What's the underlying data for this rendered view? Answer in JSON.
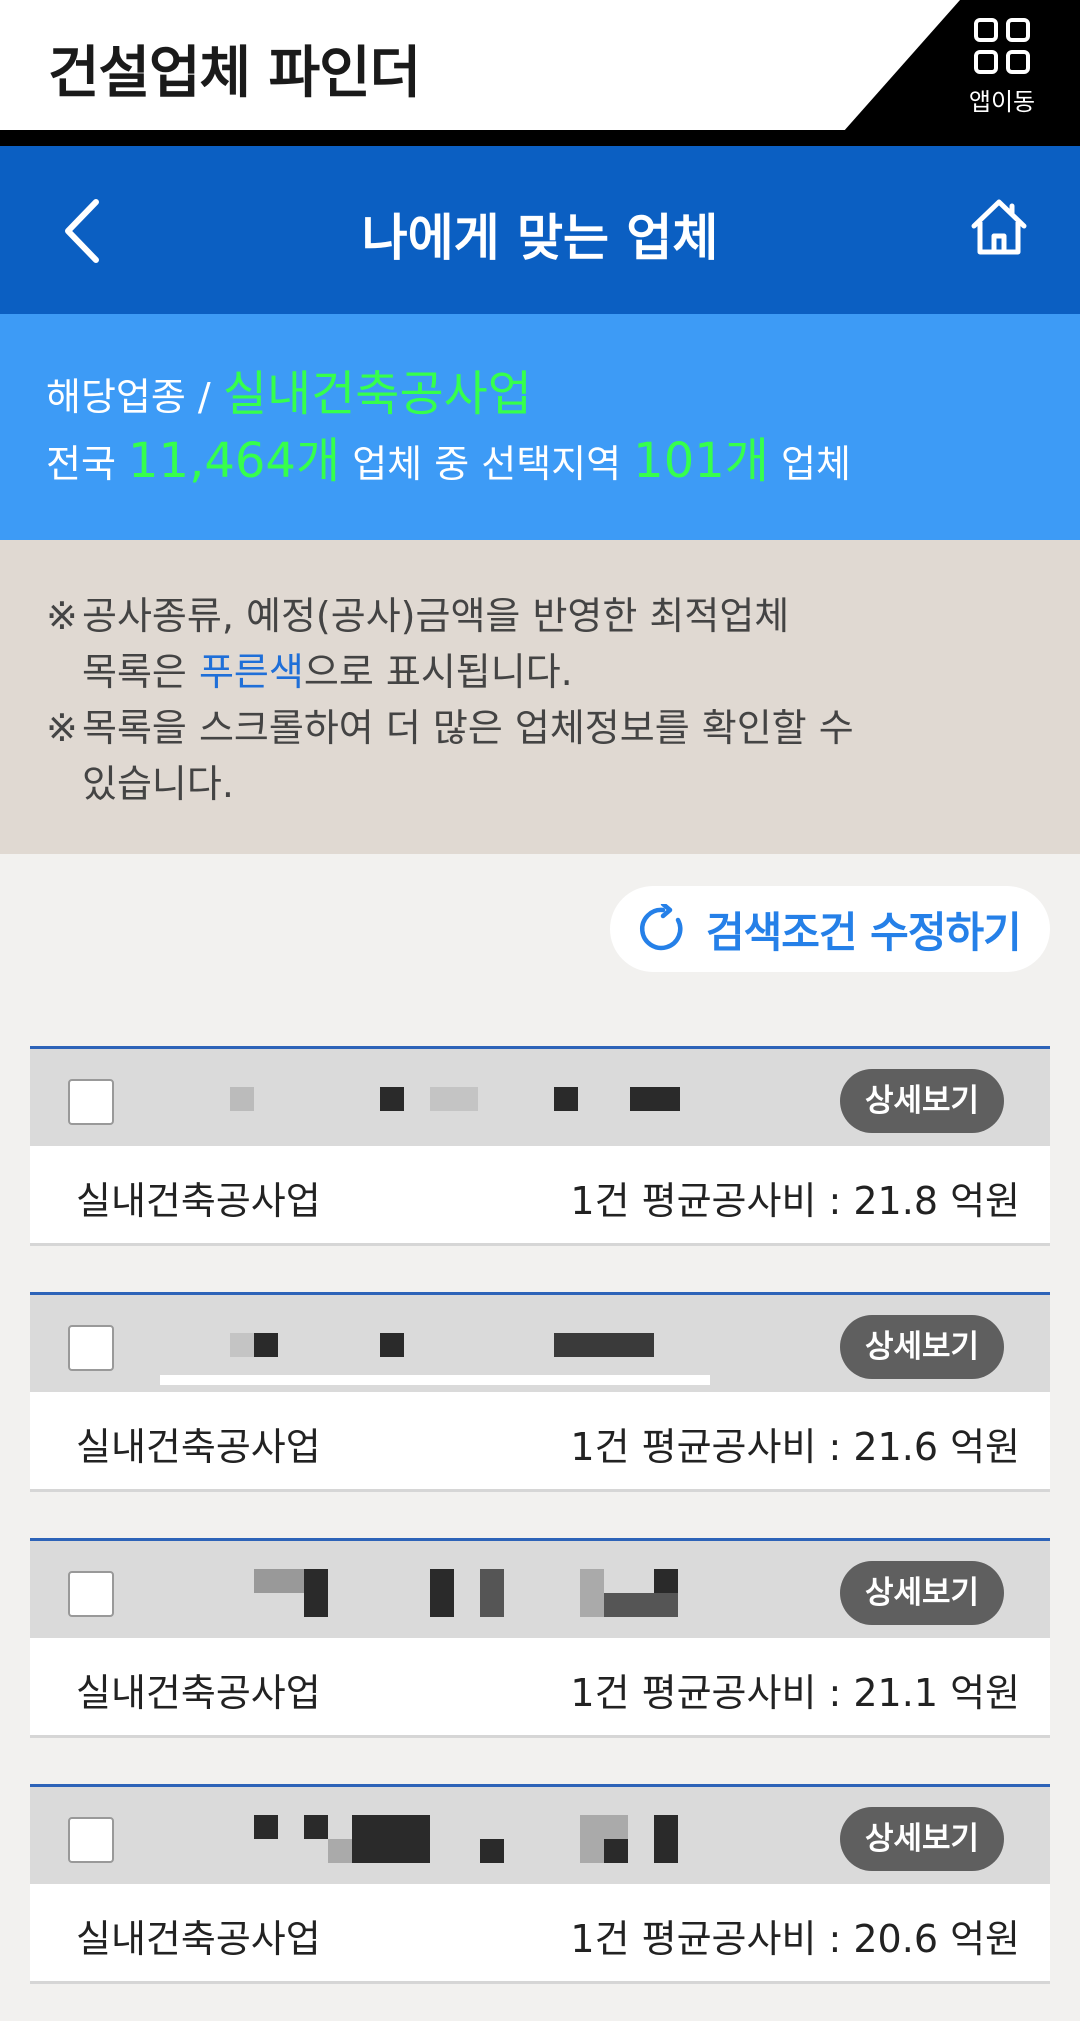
{
  "app": {
    "title": "건설업체 파인더",
    "appdong_label": "앱이동",
    "appdong_icon": "grid-icon"
  },
  "nav": {
    "title": "나에게 맞는 업체",
    "back_icon": "chevron-left-icon",
    "home_icon": "home-icon"
  },
  "summary": {
    "industry_prefix": "해당업종 / ",
    "industry": "실내건축공사업",
    "nation_prefix": "전국 ",
    "nation_count": "11,464개",
    "middle_text": " 업체 중 선택지역 ",
    "region_count": "101개",
    "suffix": " 업체"
  },
  "notice": {
    "mark": "※",
    "line1_text": "공사종류, 예정(공사)금액을 반영한 최적업체",
    "line1b_before": "목록은 ",
    "line1b_blue": "푸른색",
    "line1b_after": "으로 표시됩니다.",
    "line2_text": "목록을 스크롤하여 더 많은 업체정보를 확인할 수",
    "line2b_text": "있습니다."
  },
  "edit_search": {
    "label": "검색조건 수정하기",
    "icon": "refresh-icon"
  },
  "companies": [
    {
      "category": "실내건축공사업",
      "cost": "1건 평균공사비 : 21.8 억원",
      "detail_label": "상세보기"
    },
    {
      "category": "실내건축공사업",
      "cost": "1건 평균공사비 : 21.6 억원",
      "detail_label": "상세보기"
    },
    {
      "category": "실내건축공사업",
      "cost": "1건 평균공사비 : 21.1 억원",
      "detail_label": "상세보기"
    },
    {
      "category": "실내건축공사업",
      "cost": "1건 평균공사비 : 20.6 억원",
      "detail_label": "상세보기"
    }
  ],
  "colors": {
    "nav_blue": "#0b5fc2",
    "summary_blue": "#3d9bf6",
    "highlight_green": "#36ff4c",
    "notice_bg": "#e0d9d2"
  }
}
